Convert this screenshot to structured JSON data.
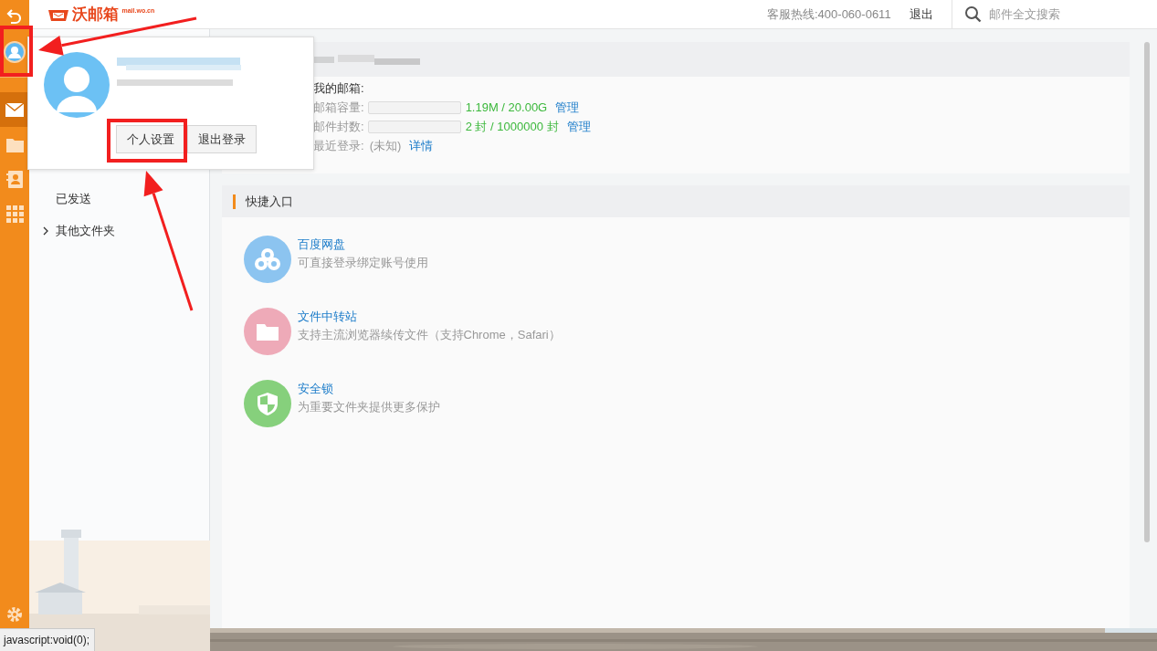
{
  "logo": {
    "name": "沃邮箱",
    "domain": "mail.wo.cn"
  },
  "rail": [
    {
      "kind": "back",
      "selected": false
    },
    {
      "kind": "avatar",
      "selected": false
    },
    {
      "kind": "mail",
      "selected": true
    },
    {
      "kind": "folder",
      "selected": false
    },
    {
      "kind": "contacts",
      "selected": false
    },
    {
      "kind": "apps",
      "selected": false
    },
    {
      "kind": "settings",
      "selected": false
    }
  ],
  "header": {
    "hotline": "客服热线:400-060-0611",
    "logout": "退出",
    "search": {
      "placeholder": "邮件全文搜索"
    }
  },
  "folders": [
    {
      "label": "已发送",
      "expandable": false
    },
    {
      "label": "其他文件夹",
      "expandable": true
    }
  ],
  "account_popup": {
    "buttons": [
      {
        "label": "个人设置"
      },
      {
        "label": "退出登录"
      }
    ]
  },
  "mailbox": {
    "title": "我的邮箱:",
    "rows": [
      {
        "kind": "meter",
        "label": "邮箱容量:",
        "level": 0,
        "reading": "1.19M / 20.00G",
        "link": "管理"
      },
      {
        "kind": "meter",
        "label": "邮件封数:",
        "level": 0,
        "reading": "2 封 / 1000000 封",
        "link": "管理"
      },
      {
        "kind": "text",
        "label": "最近登录:",
        "value": "(未知)",
        "link": "详情"
      }
    ]
  },
  "shortcuts": {
    "title": "快捷入口",
    "items": [
      {
        "kind": "cloud",
        "title": "百度网盘",
        "description": "可直接登录绑定账号使用",
        "color": "#8cc4f0"
      },
      {
        "kind": "folder",
        "title": "文件中转站",
        "description": "支持主流浏览器续传文件（支持Chrome，Safari）",
        "color": "#eeaab8"
      },
      {
        "kind": "shield",
        "title": "安全锁",
        "description": "为重要文件夹提供更多保护",
        "color": "#86d07c"
      }
    ]
  },
  "status_bar": {
    "text": "javascript:void(0);"
  },
  "annotations": [
    {
      "kind": "box"
    },
    {
      "kind": "box"
    },
    {
      "kind": "arrow"
    },
    {
      "kind": "arrow"
    }
  ]
}
